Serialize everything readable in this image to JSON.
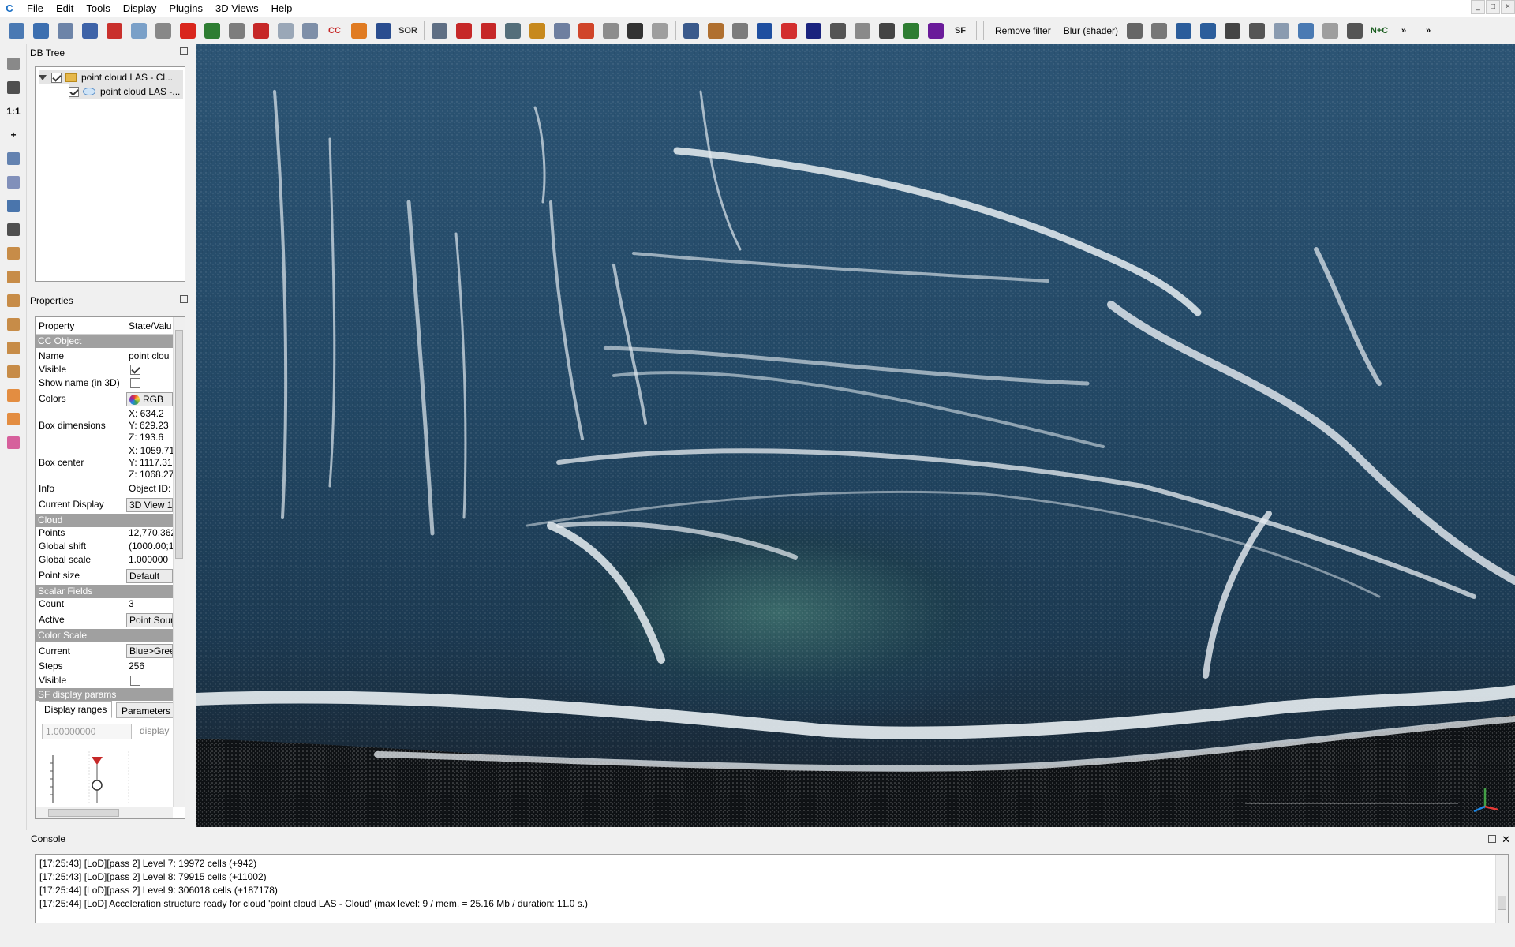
{
  "app_icon": "C",
  "menu": [
    "File",
    "Edit",
    "Tools",
    "Display",
    "Plugins",
    "3D Views",
    "Help"
  ],
  "toolbar": {
    "icons_left": [
      {
        "name": "edit-pencil-icon",
        "color": "#4a79b3"
      },
      {
        "name": "save-icon",
        "color": "#3c6fb0"
      },
      {
        "name": "gear-tool-icon",
        "color": "#6d84a8"
      },
      {
        "name": "list-icon",
        "color": "#3e63a8"
      },
      {
        "name": "point-picking-icon",
        "color": "#c9302c"
      },
      {
        "name": "cloud-points-icon",
        "color": "#7aa0c8"
      },
      {
        "name": "export-icon",
        "color": "#888888"
      },
      {
        "name": "delete-icon",
        "color": "#d9261c"
      },
      {
        "name": "merge-icon",
        "color": "#2e7d32"
      },
      {
        "name": "segment-icon",
        "color": "#7d7d7d"
      },
      {
        "name": "sample-icon",
        "color": "#c62828"
      },
      {
        "name": "subsample-icon",
        "color": "#9aa7b7"
      },
      {
        "name": "noise-icon",
        "color": "#7e8fa8"
      }
    ],
    "cc_label": "CC",
    "icons_mid": [
      {
        "name": "flame-icon",
        "color": "#e07b22"
      },
      {
        "name": "checker-icon",
        "color": "#2a4d8f"
      }
    ],
    "sor_label": "SOR",
    "icons_group2": [
      {
        "name": "scissors-icon",
        "color": "#5f6f84"
      },
      {
        "name": "translate-icon",
        "color": "#c62828"
      },
      {
        "name": "plane-icon",
        "color": "#c62828"
      },
      {
        "name": "crosshair-icon",
        "color": "#546e7a"
      }
    ],
    "icons_group3": [
      {
        "name": "histogram-icon",
        "color": "#c7891e"
      },
      {
        "name": "curve-icon",
        "color": "#6e7fa0"
      },
      {
        "name": "sf-filter-icon",
        "color": "#d0452a"
      },
      {
        "name": "table-icon",
        "color": "#8d8d8d"
      },
      {
        "name": "plus-icon",
        "color": "#333333"
      },
      {
        "name": "calculator-icon",
        "color": "#9e9e9e"
      }
    ],
    "sf_label": "SF",
    "icons_group4": [
      {
        "name": "film-icon",
        "color": "#3a5a8c"
      },
      {
        "name": "brush-icon",
        "color": "#b07030"
      },
      {
        "name": "shield-icon",
        "color": "#7b7b7b"
      },
      {
        "name": "globe-icon",
        "color": "#1f4fa0"
      },
      {
        "name": "ellipse-icon",
        "color": "#d32f2f"
      },
      {
        "name": "north-icon",
        "color": "#1a237e"
      },
      {
        "name": "hpr-icon",
        "color": "#555555"
      },
      {
        "name": "m3c2-icon",
        "color": "#8a8a8a"
      },
      {
        "name": "pcv-icon",
        "color": "#444444"
      },
      {
        "name": "sphere-green-icon",
        "color": "#2e7d32"
      },
      {
        "name": "rgb-icon",
        "color": "#6a1b9a"
      }
    ],
    "remove_filter": "Remove filter",
    "blur_shader": "Blur (shader)",
    "icons_group5": [
      {
        "name": "ssao-icon",
        "color": "#666666"
      },
      {
        "name": "edl-icon",
        "color": "#777777"
      },
      {
        "name": "canupo-create-icon",
        "color": "#2b5d9b"
      },
      {
        "name": "canupo-classify-icon",
        "color": "#2b5d9b"
      },
      {
        "name": "kd-icon",
        "color": "#444444"
      },
      {
        "name": "fm-icon",
        "color": "#555555"
      },
      {
        "name": "camera-icon",
        "color": "#8a9bb0"
      },
      {
        "name": "display-icon",
        "color": "#4a7ab3"
      },
      {
        "name": "sphere-grey-icon",
        "color": "#9e9e9e"
      },
      {
        "name": "ball-icon",
        "color": "#555555"
      }
    ],
    "nc_label": "N+C",
    "overflow": "»",
    "overflow2": "»"
  },
  "left_tools": [
    {
      "name": "pencil-icon",
      "label": ""
    },
    {
      "name": "camera-snapshot-icon",
      "label": ""
    },
    {
      "name": "zoom-1to1-icon",
      "label": "1:1"
    },
    {
      "name": "pivot-plus-icon",
      "label": "+"
    },
    {
      "name": "perspective-icon",
      "label": ""
    },
    {
      "name": "object-cube-icon",
      "label": ""
    },
    {
      "name": "move-icon",
      "label": ""
    },
    {
      "name": "zoom-icon",
      "label": ""
    },
    {
      "name": "view-top-icon",
      "label": ""
    },
    {
      "name": "view-front-icon",
      "label": ""
    },
    {
      "name": "view-left-icon",
      "label": ""
    },
    {
      "name": "view-back-icon",
      "label": ""
    },
    {
      "name": "view-right-icon",
      "label": ""
    },
    {
      "name": "view-bottom-icon",
      "label": ""
    },
    {
      "name": "view-front-iso-icon",
      "label": ""
    },
    {
      "name": "view-back-iso-icon",
      "label": ""
    },
    {
      "name": "stereo-icon",
      "label": ""
    }
  ],
  "db_tree": {
    "title": "DB Tree",
    "items": [
      {
        "label": "point cloud LAS - Cl...",
        "checked": true,
        "type": "folder"
      },
      {
        "label": "point cloud LAS -...",
        "checked": true,
        "type": "cloud"
      }
    ]
  },
  "properties": {
    "title": "Properties",
    "col_property": "Property",
    "col_value": "State/Valu",
    "sections": {
      "cc_object": "CC Object",
      "cloud": "Cloud",
      "scalar_fields": "Scalar Fields",
      "color_scale": "Color Scale",
      "sf_display": "SF display params"
    },
    "name_k": "Name",
    "name_v": "point clou",
    "visible_k": "Visible",
    "show_name_k": "Show name (in 3D)",
    "colors_k": "Colors",
    "colors_v": "RGB",
    "box_dim_k": "Box dimensions",
    "box_dim_x": "X: 634.2",
    "box_dim_y": "Y: 629.23",
    "box_dim_z": "Z: 193.6",
    "box_center_k": "Box center",
    "box_center_x": "X: 1059.71",
    "box_center_y": "Y: 1117.31",
    "box_center_z": "Z: 1068.27",
    "info_k": "Info",
    "info_v": "Object ID:",
    "current_display_k": "Current Display",
    "current_display_v": "3D View 1",
    "points_k": "Points",
    "points_v": "12,770,362",
    "global_shift_k": "Global shift",
    "global_shift_v": "(1000.00;1(",
    "global_scale_k": "Global scale",
    "global_scale_v": "1.000000",
    "point_size_k": "Point size",
    "point_size_v": "Default",
    "count_k": "Count",
    "count_v": "3",
    "active_k": "Active",
    "active_v": "Point Sour",
    "current_k": "Current",
    "current_v": "Blue>Gree",
    "steps_k": "Steps",
    "steps_v": "256",
    "cs_visible_k": "Visible",
    "tab_display": "Display ranges",
    "tab_params": "Parameters",
    "spin_value": "1.00000000",
    "spin_label": "display"
  },
  "console": {
    "title": "Console",
    "lines": [
      "[17:25:43] [LoD][pass 2] Level 7: 19972 cells (+942)",
      "[17:25:43] [LoD][pass 2] Level 8: 79915 cells (+11002)",
      "[17:25:44] [LoD][pass 2] Level 9: 306018 cells (+187178)",
      "[17:25:44] [LoD] Acceleration structure ready for cloud 'point cloud LAS - Cloud' (max level: 9 / mem. = 25.16 Mb / duration: 11.0 s.)"
    ]
  },
  "window_controls": [
    "_",
    "□",
    "×"
  ]
}
